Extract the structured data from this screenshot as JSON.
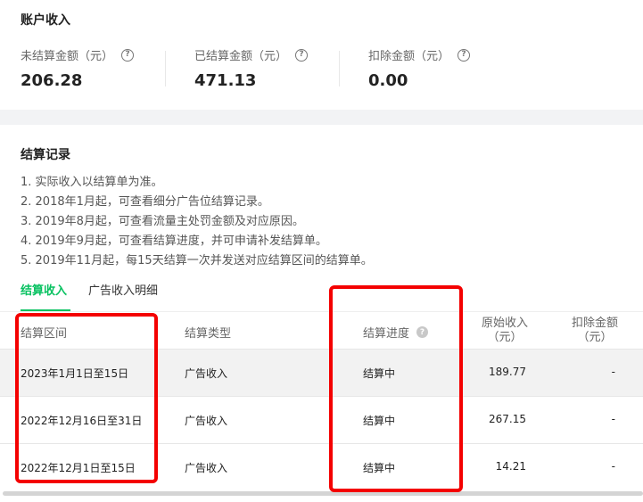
{
  "account": {
    "title": "账户收入",
    "stats": [
      {
        "label": "未结算金额（元）",
        "value": "206.28"
      },
      {
        "label": "已结算金额（元）",
        "value": "471.13"
      },
      {
        "label": "扣除金额（元）",
        "value": "0.00"
      }
    ]
  },
  "settle": {
    "title": "结算记录",
    "notes": [
      "1. 实际收入以结算单为准。",
      "2. 2018年1月起，可查看细分广告位结算记录。",
      "3. 2019年8月起，可查看流量主处罚金额及对应原因。",
      "4. 2019年9月起，可查看结算进度，并可申请补发结算单。",
      "5. 2019年11月起，每15天结算一次并发送对应结算区间的结算单。"
    ],
    "tabs": [
      {
        "label": "结算收入",
        "active": true
      },
      {
        "label": "广告收入明细",
        "active": false
      }
    ],
    "table": {
      "headers": {
        "period": "结算区间",
        "type": "结算类型",
        "progress": "结算进度",
        "original_1": "原始收入",
        "original_2": "（元）",
        "deduct_1": "扣除金额",
        "deduct_2": "（元）"
      },
      "rows": [
        {
          "period": "2023年1月1日至15日",
          "type": "广告收入",
          "progress": "结算中",
          "original": "189.77",
          "deduct": "-"
        },
        {
          "period": "2022年12月16日至31日",
          "type": "广告收入",
          "progress": "结算中",
          "original": "267.15",
          "deduct": "-"
        },
        {
          "period": "2022年12月1日至15日",
          "type": "广告收入",
          "progress": "结算中",
          "original": "14.21",
          "deduct": "-"
        }
      ]
    }
  },
  "colors": {
    "accent": "#07c160",
    "highlight": "#f40000",
    "shaded_row": "#f2f2f2"
  },
  "icons": {
    "help": "question-circle-icon"
  }
}
